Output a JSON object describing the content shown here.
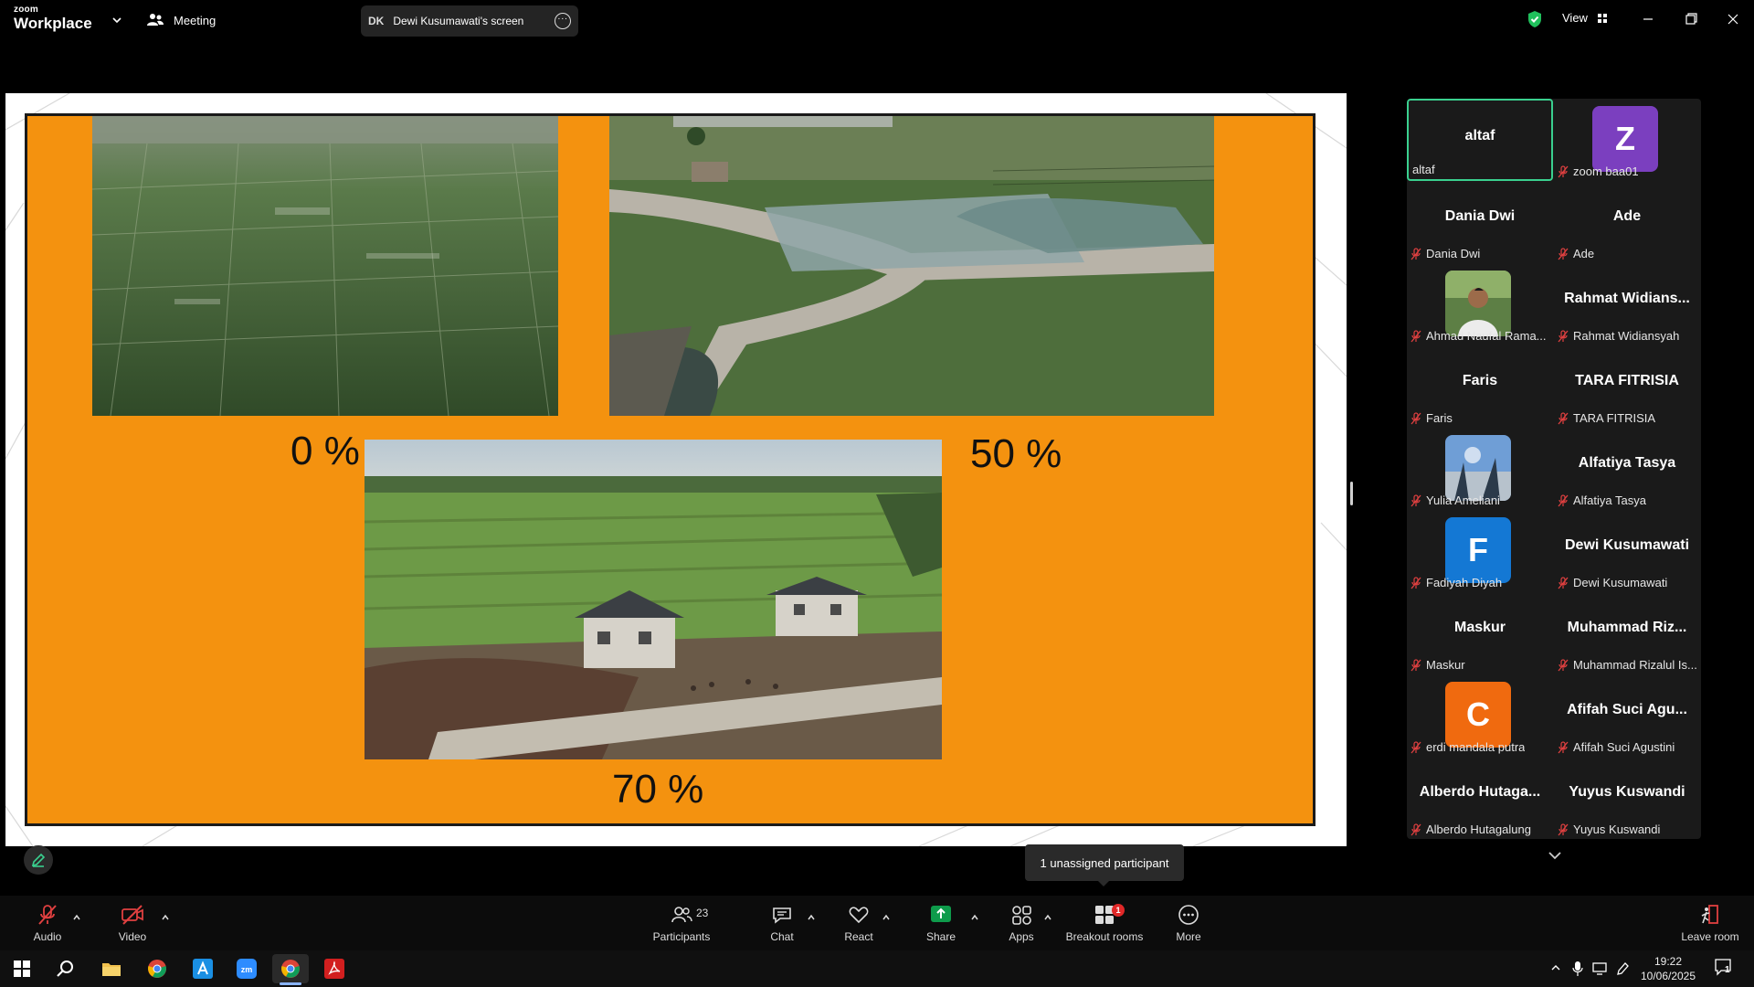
{
  "app": {
    "brand_small": "zoom",
    "brand_big": "Workplace",
    "meeting_label": "Meeting",
    "screen_initials": "DK",
    "screen_title": "Dewi Kusumawati's screen",
    "view_label": "View",
    "security_color": "#20c05c"
  },
  "slide": {
    "background": "#f4920f",
    "labels": [
      "0 %",
      "50 %",
      "70 %"
    ]
  },
  "gallery": {
    "tiles": [
      {
        "name": "altaf",
        "label": "altaf",
        "active": true,
        "avatar": null,
        "muted": false
      },
      {
        "name": "",
        "label": "zoom baa01",
        "avatar": {
          "type": "letter",
          "letter": "Z",
          "color": "#7b3fbf"
        },
        "muted": true
      },
      {
        "name": "Dania Dwi",
        "label": "Dania Dwi",
        "avatar": null,
        "muted": true
      },
      {
        "name": "Ade",
        "label": "Ade",
        "avatar": null,
        "muted": true
      },
      {
        "name": "",
        "label": "Ahmad Naufal Rama...",
        "avatar": {
          "type": "photo"
        },
        "muted": true
      },
      {
        "name": "Rahmat  Widians...",
        "label": "Rahmat Widiansyah",
        "avatar": null,
        "muted": true
      },
      {
        "name": "Faris",
        "label": "Faris",
        "avatar": null,
        "muted": true
      },
      {
        "name": "TARA FITRISIA",
        "label": "TARA FITRISIA",
        "avatar": null,
        "muted": true
      },
      {
        "name": "",
        "label": "Yulia Ameliani",
        "avatar": {
          "type": "photo-sky"
        },
        "muted": true
      },
      {
        "name": "Alfatiya Tasya",
        "label": "Alfatiya Tasya",
        "avatar": null,
        "muted": true
      },
      {
        "name": "",
        "label": "Fadiyah Diyah",
        "avatar": {
          "type": "letter",
          "letter": "F",
          "color": "#1478d4"
        },
        "muted": true
      },
      {
        "name": "Dewi Kusumawati",
        "label": "Dewi Kusumawati",
        "avatar": null,
        "muted": true
      },
      {
        "name": "Maskur",
        "label": "Maskur",
        "avatar": null,
        "muted": true
      },
      {
        "name": "Muhammad  Riz...",
        "label": "Muhammad Rizalul Is...",
        "avatar": null,
        "muted": true
      },
      {
        "name": "",
        "label": "erdi mandala putra",
        "avatar": {
          "type": "letter",
          "letter": "C",
          "color": "#f06a0f"
        },
        "muted": true
      },
      {
        "name": "Afifah Suci Agu...",
        "label": "Afifah Suci Agustini",
        "avatar": null,
        "muted": true
      },
      {
        "name": "Alberdo  Hutaga...",
        "label": "Alberdo Hutagalung",
        "avatar": null,
        "muted": true
      },
      {
        "name": "Yuyus Kuswandi",
        "label": "Yuyus Kuswandi",
        "avatar": null,
        "muted": true
      }
    ]
  },
  "tooltip": "1 unassigned participant",
  "toolbar": {
    "audio": "Audio",
    "video": "Video",
    "participants": "Participants",
    "participants_count": "23",
    "chat": "Chat",
    "react": "React",
    "share": "Share",
    "apps": "Apps",
    "breakout": "Breakout rooms",
    "breakout_badge": "1",
    "more": "More",
    "leave": "Leave room",
    "share_color": "#0e9b4b"
  },
  "taskbar": {
    "time": "19:22",
    "date": "10/06/2025",
    "notification_count": "1"
  }
}
